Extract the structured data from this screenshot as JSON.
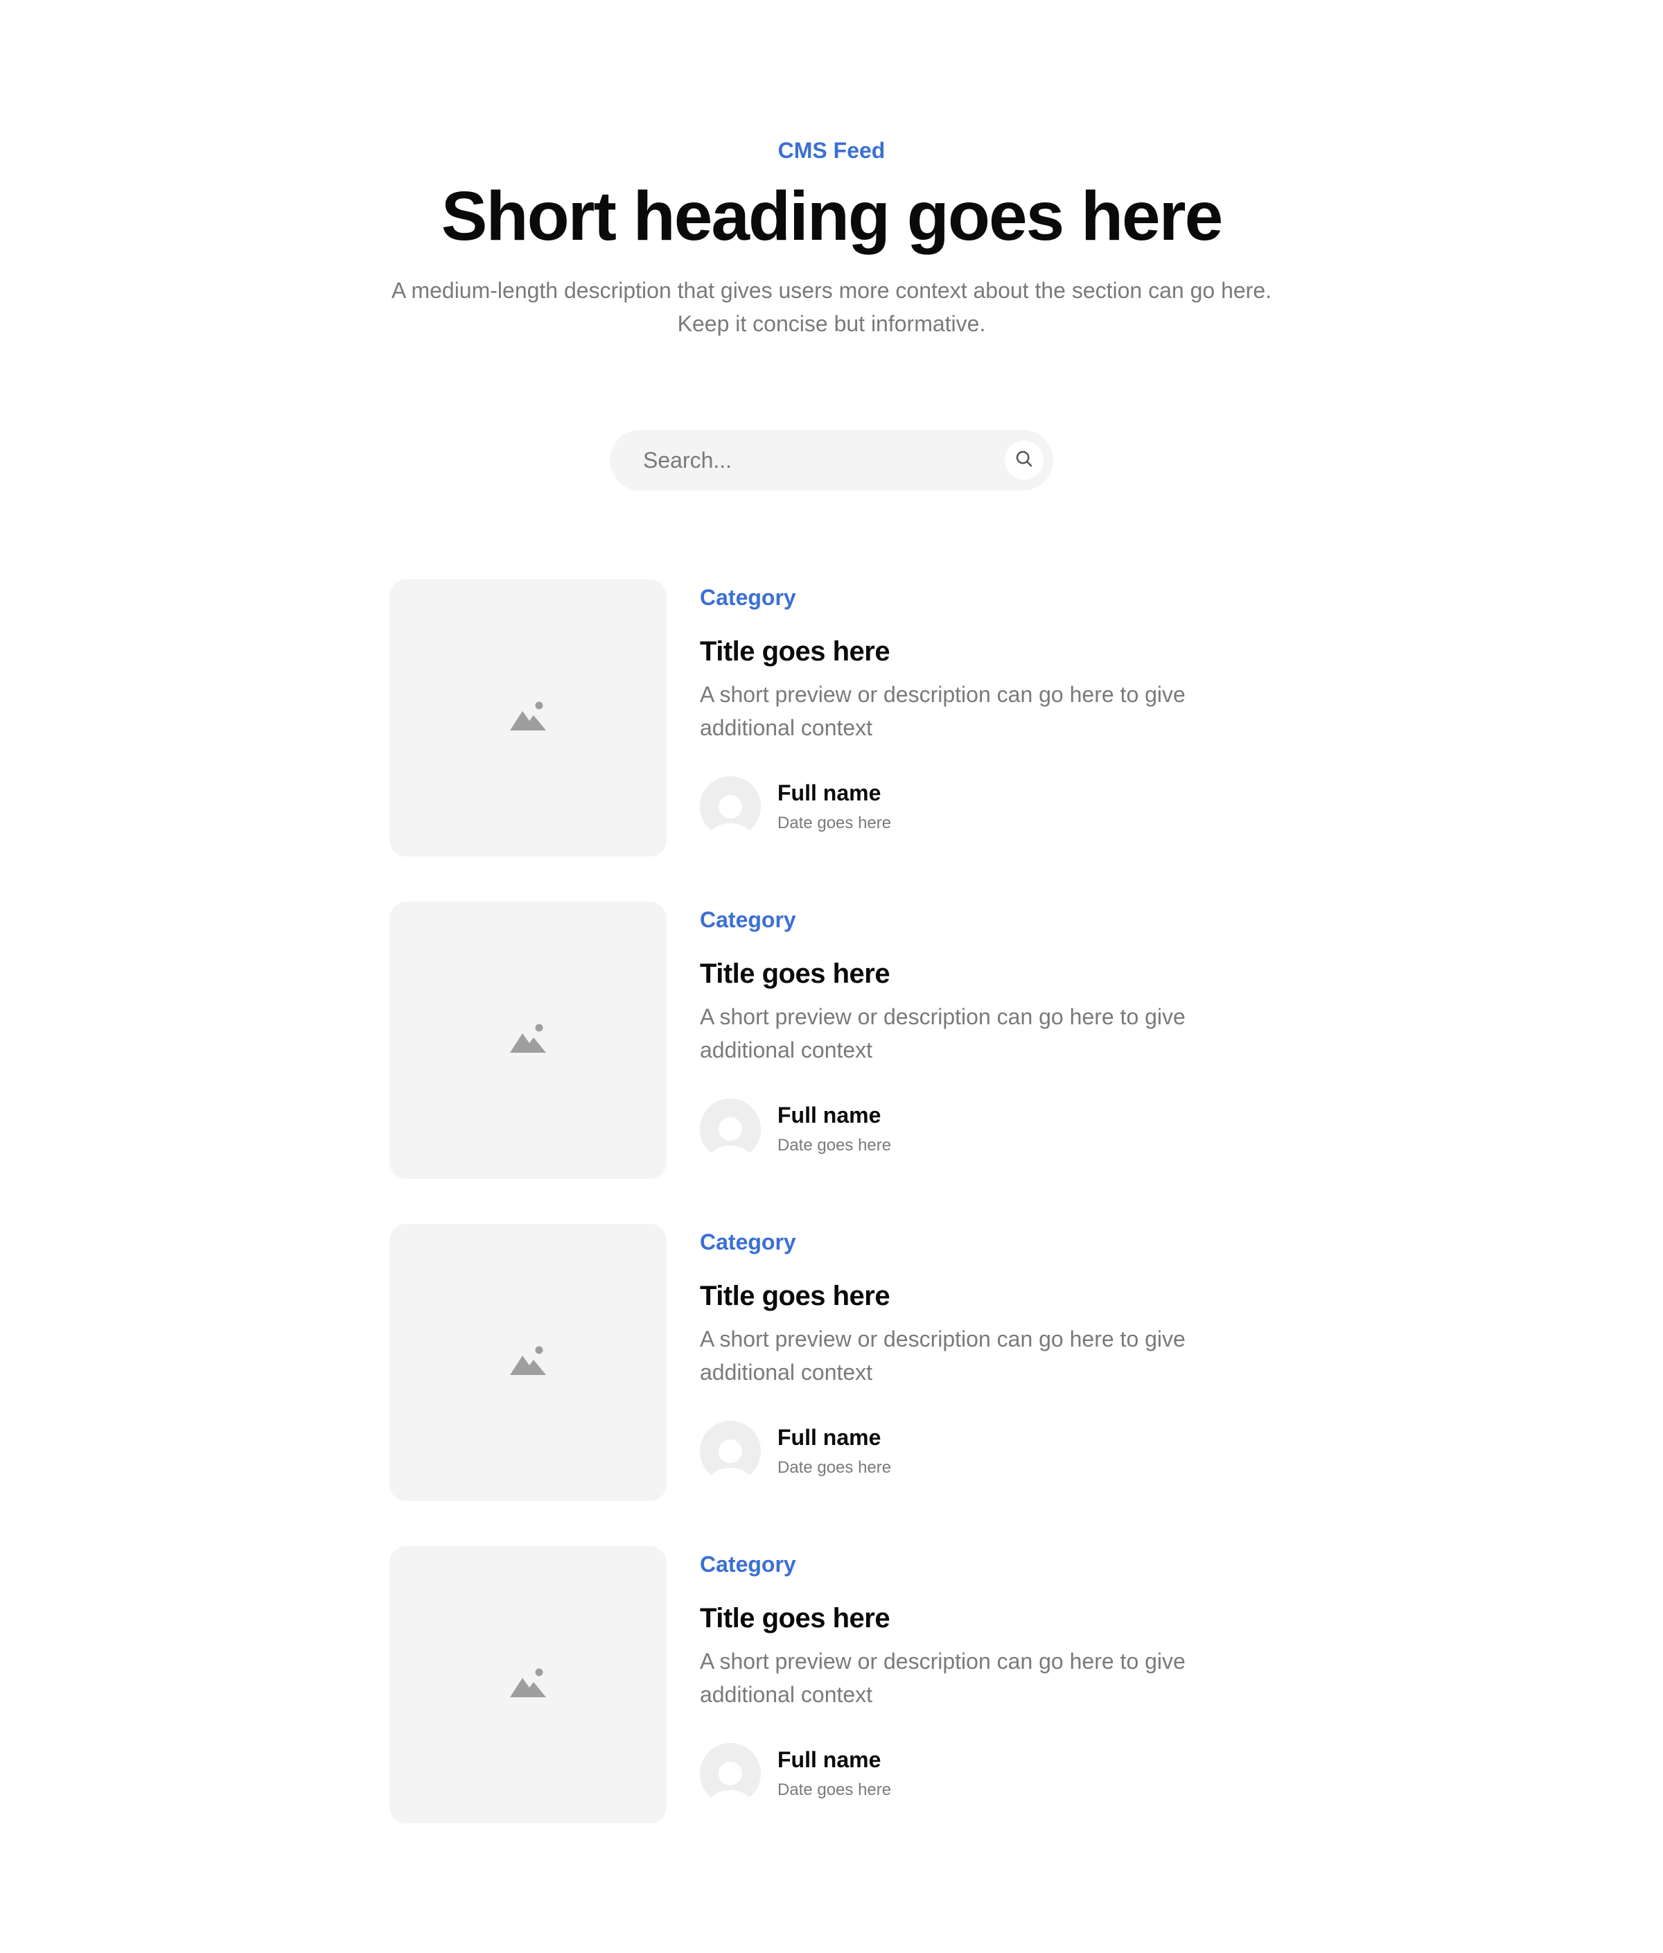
{
  "header": {
    "eyebrow": "CMS Feed",
    "heading": "Short heading goes here",
    "description": "A medium-length description that gives users more context about the section can go here. Keep it concise but informative."
  },
  "search": {
    "placeholder": "Search...",
    "icon": "search-icon"
  },
  "colors": {
    "accent": "#3b6fd4",
    "text": "#0a0a0a",
    "muted": "#7a7a7a",
    "surface": "#f4f4f4"
  },
  "posts": [
    {
      "thumbnail_icon": "image-placeholder-icon",
      "category": "Category",
      "title": "Title goes here",
      "excerpt": "A short preview or description can go here to give additional context",
      "author": {
        "name": "Full name",
        "date": "Date goes here",
        "avatar_icon": "user-avatar-icon"
      }
    },
    {
      "thumbnail_icon": "image-placeholder-icon",
      "category": "Category",
      "title": "Title goes here",
      "excerpt": "A short preview or description can go here to give additional context",
      "author": {
        "name": "Full name",
        "date": "Date goes here",
        "avatar_icon": "user-avatar-icon"
      }
    },
    {
      "thumbnail_icon": "image-placeholder-icon",
      "category": "Category",
      "title": "Title goes here",
      "excerpt": "A short preview or description can go here to give additional context",
      "author": {
        "name": "Full name",
        "date": "Date goes here",
        "avatar_icon": "user-avatar-icon"
      }
    },
    {
      "thumbnail_icon": "image-placeholder-icon",
      "category": "Category",
      "title": "Title goes here",
      "excerpt": "A short preview or description can go here to give additional context",
      "author": {
        "name": "Full name",
        "date": "Date goes here",
        "avatar_icon": "user-avatar-icon"
      }
    }
  ]
}
